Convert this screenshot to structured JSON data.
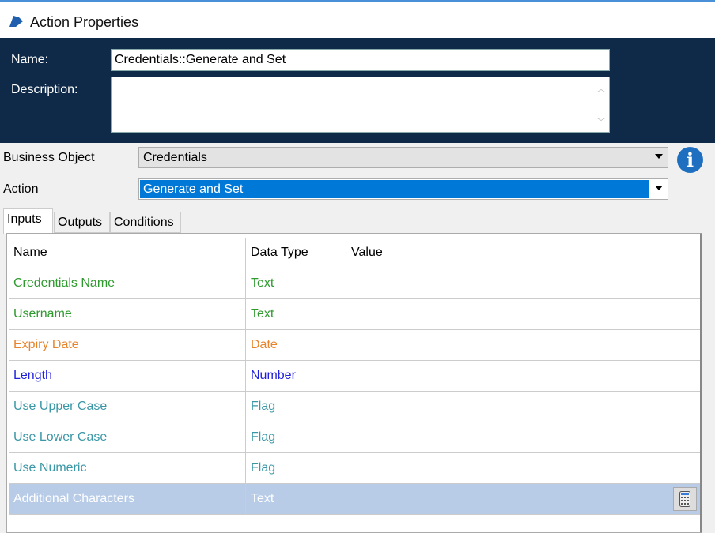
{
  "window": {
    "title": "Action Properties"
  },
  "header": {
    "name_label": "Name:",
    "name_value": "Credentials::Generate and Set",
    "description_label": "Description:",
    "description_value": ""
  },
  "business_object": {
    "label": "Business Object",
    "value": "Credentials"
  },
  "action": {
    "label": "Action",
    "value": "Generate and Set"
  },
  "tabs": [
    "Inputs",
    "Outputs",
    "Conditions"
  ],
  "grid": {
    "columns": [
      "Name",
      "Data Type",
      "Value"
    ],
    "rows": [
      {
        "name": "Credentials Name",
        "type": "Text",
        "value": "",
        "color": "#2e9a2e"
      },
      {
        "name": "Username",
        "type": "Text",
        "value": "",
        "color": "#2e9a2e"
      },
      {
        "name": "Expiry Date",
        "type": "Date",
        "value": "",
        "color": "#e8842c"
      },
      {
        "name": "Length",
        "type": "Number",
        "value": "",
        "color": "#2222dd"
      },
      {
        "name": "Use Upper Case",
        "type": "Flag",
        "value": "",
        "color": "#3a97a6"
      },
      {
        "name": "Use Lower Case",
        "type": "Flag",
        "value": "",
        "color": "#3a97a6"
      },
      {
        "name": "Use Numeric",
        "type": "Flag",
        "value": "",
        "color": "#3a97a6"
      },
      {
        "name": "Additional Characters",
        "type": "Text",
        "value": "",
        "color": "#ffffff"
      }
    ]
  }
}
